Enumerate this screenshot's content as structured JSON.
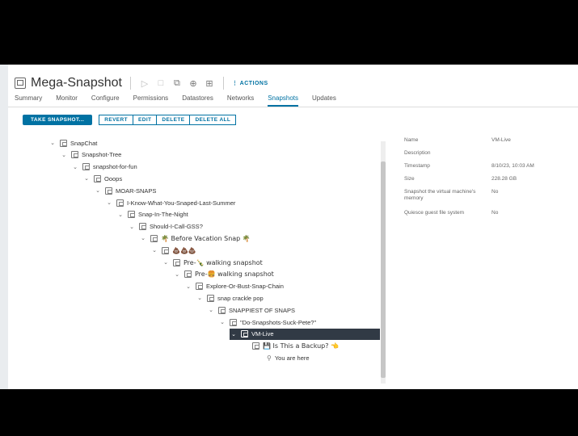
{
  "title": "Mega-Snapshot",
  "actions_label": "ACTIONS",
  "tabs": [
    "Summary",
    "Monitor",
    "Configure",
    "Permissions",
    "Datastores",
    "Networks",
    "Snapshots",
    "Updates"
  ],
  "active_tab": "Snapshots",
  "toolbar": {
    "take_snapshot": "TAKE SNAPSHOT...",
    "revert": "REVERT",
    "edit": "EDIT",
    "delete": "DELETE",
    "delete_all": "DELETE ALL"
  },
  "tree": [
    {
      "label": "SnapChat"
    },
    {
      "label": "Snapshot-Tree"
    },
    {
      "label": "snapshot-for-fun"
    },
    {
      "label": "Ooops"
    },
    {
      "label": "MOAR-SNAPS"
    },
    {
      "label": "I-Know-What-You-Snaped-Last-Summer"
    },
    {
      "label": "Snap-In-The-Night"
    },
    {
      "label": "Should-I-Call-GSS?"
    },
    {
      "label": "🌴 Before Vacation Snap 🌴"
    },
    {
      "label": "💩💩💩"
    },
    {
      "label": "Pre-🍾 walking snapshot"
    },
    {
      "label": "Pre-🍔 walking snapshot"
    },
    {
      "label": "Explore-Or-Bust-Snap-Chain"
    },
    {
      "label": "snap crackle pop"
    },
    {
      "label": "SNAPPIEST OF SNAPS"
    },
    {
      "label": "\"Do-Snapshots-Suck-Pete?\""
    },
    {
      "label": "VM-Live"
    },
    {
      "label": "💾 Is This a Backup? 👈"
    },
    {
      "label": "You are here"
    }
  ],
  "details": [
    {
      "label": "Name",
      "value": "VM-Live"
    },
    {
      "label": "Description",
      "value": ""
    },
    {
      "label": "Timestamp",
      "value": "8/10/23, 10:03 AM"
    },
    {
      "label": "Size",
      "value": "228.28 GB"
    },
    {
      "label": "Snapshot the virtual machine's memory",
      "value": "No"
    },
    {
      "label": "Quiesce guest file system",
      "value": "No"
    }
  ],
  "colors": {
    "accent": "#0072a3",
    "selected_row": "#313a45"
  },
  "icons": [
    "vm-icon",
    "snapshot-icon",
    "chevron-down-icon",
    "location-pin-icon"
  ]
}
